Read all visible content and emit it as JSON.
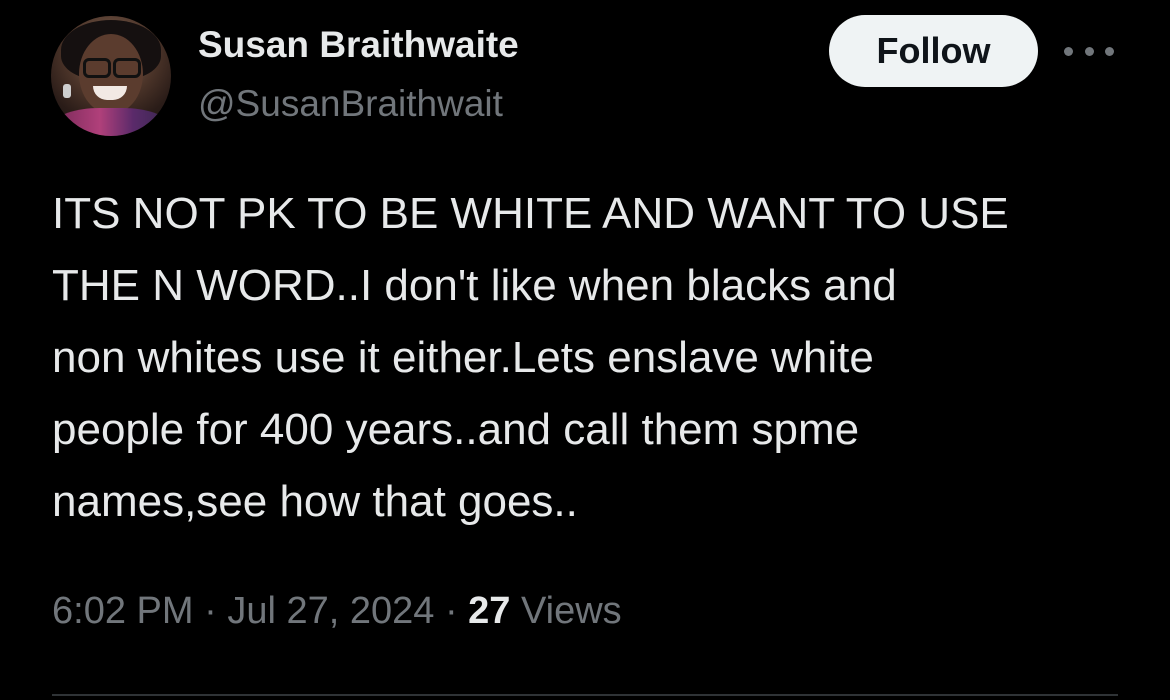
{
  "tweet": {
    "author": {
      "name": "Susan Braithwaite",
      "handle": "@SusanBraithwait"
    },
    "follow_label": "Follow",
    "more_icon": "more-dots-icon",
    "body_lines": [
      "ITS NOT PK TO BE WHITE AND WANT TO USE",
      "THE N WORD..I don't like when blacks and",
      "non whites use it either.Lets enslave white",
      "people for 400 years..and call them spme",
      "names,see how that goes.."
    ],
    "time": "6:02 PM",
    "date": "Jul 27, 2024",
    "separator": "·",
    "views_count": "27",
    "views_label": "Views"
  },
  "colors": {
    "background": "#000000",
    "text_primary": "#e7e9ea",
    "text_secondary": "#71767b",
    "follow_bg": "#eff3f4",
    "divider": "#2f3336"
  }
}
